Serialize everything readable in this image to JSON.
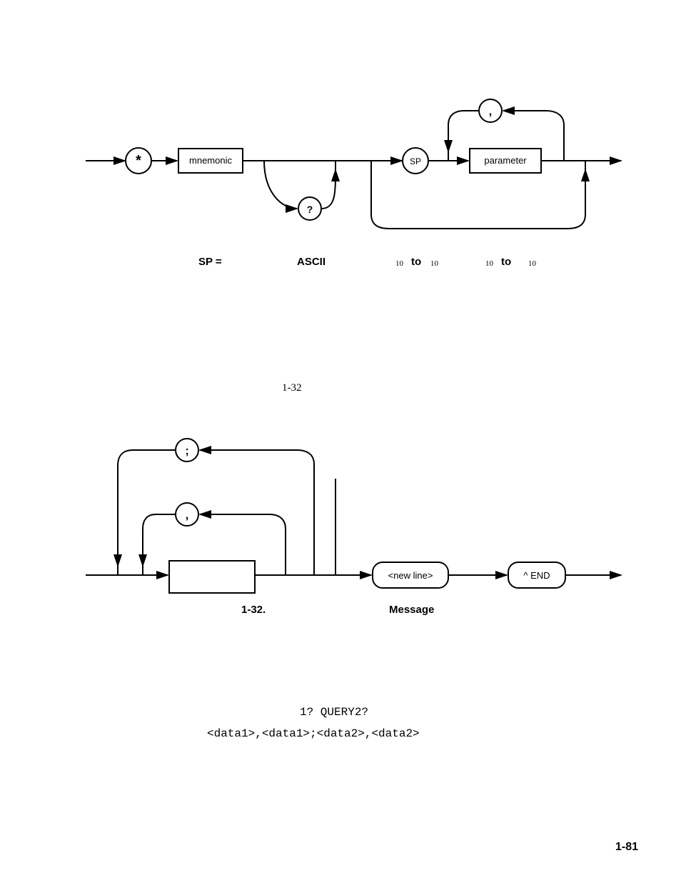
{
  "diagram1": {
    "star": "*",
    "mnemonic": "mnemonic",
    "question": "?",
    "sp": "SP",
    "comma": ",",
    "parameter": "parameter",
    "sp_eq": "SP  =",
    "ascii": "ASCII",
    "sub10a": "10",
    "to_a": "to",
    "sub10b": "10",
    "sub10c": "10",
    "to_b": "to",
    "sub10d": "10"
  },
  "midref": "1-32",
  "diagram2": {
    "semicolon": ";",
    "comma": ",",
    "newline": "<new  line>",
    "end": "^ END",
    "label_left": "1-32.",
    "label_right": "Message"
  },
  "example": {
    "line1": "1?  QUERY2?",
    "line2": "<data1>,<data1>;<data2>,<data2>"
  },
  "pagefoot": "1-81"
}
